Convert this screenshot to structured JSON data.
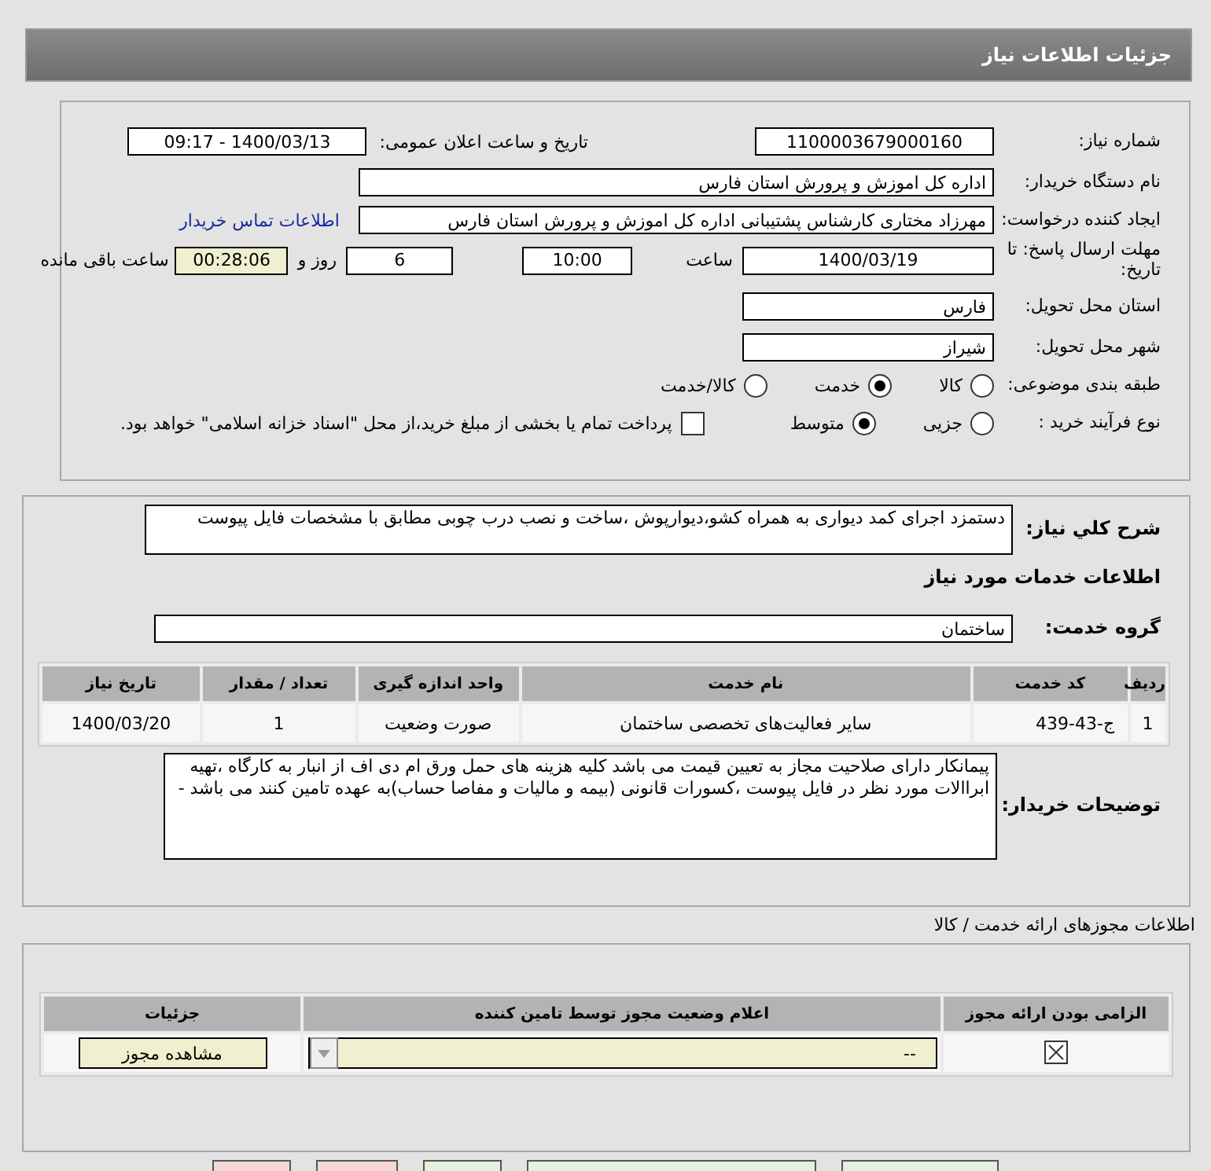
{
  "header": {
    "title": "جزئیات اطلاعات نیاز"
  },
  "need_number": {
    "label": "شماره نیاز:",
    "value": "1100003679000160"
  },
  "announce": {
    "label": "تاریخ و ساعت اعلان عمومی:",
    "value": "1400/03/13 - 09:17"
  },
  "buyer_org": {
    "label": "نام دستگاه خریدار:",
    "value": "اداره کل اموزش و پرورش استان فارس"
  },
  "requester": {
    "label": "ایجاد کننده درخواست:",
    "value": "مهرزاد  مختاری  کارشناس پشتیبانی اداره کل اموزش و پرورش استان فارس",
    "link": "اطلاعات تماس خریدار"
  },
  "deadline": {
    "label": "مهلت ارسال پاسخ: تا تاریخ:",
    "date": "1400/03/19",
    "time_label": "ساعت",
    "time": "10:00",
    "days": "6",
    "days_label": "روز و",
    "remaining": "00:28:06",
    "remaining_label": "ساعت باقی مانده"
  },
  "province": {
    "label": "استان محل تحویل:",
    "value": "فارس"
  },
  "city": {
    "label": "شهر محل تحویل:",
    "value": "شیراز"
  },
  "category": {
    "label": "طبقه بندی موضوعی:",
    "options": [
      {
        "label": "کالا",
        "selected": false
      },
      {
        "label": "خدمت",
        "selected": true
      },
      {
        "label": "کالا/خدمت",
        "selected": false
      }
    ]
  },
  "process": {
    "label": "نوع فرآیند خرید :",
    "options": [
      {
        "label": "جزیی",
        "selected": false
      },
      {
        "label": "متوسط",
        "selected": true
      }
    ],
    "payment": {
      "checked": false,
      "label": "پرداخت تمام یا بخشی از مبلغ خرید،از محل \"اسناد خزانه اسلامی\" خواهد بود."
    }
  },
  "description": {
    "label": "شرح کلي نياز:",
    "value": "دستمزد اجرای کمد دیواری به همراه کشو،دیوارپوش ،ساخت و نصب درب چوبی مطابق با مشخصات فایل پیوست"
  },
  "services_heading": "اطلاعات خدمات مورد نیاز",
  "service_group": {
    "label": "گروه خدمت:",
    "value": "ساختمان"
  },
  "services_table": {
    "columns": [
      "ردیف",
      "کد خدمت",
      "نام خدمت",
      "واحد اندازه گیری",
      "تعداد / مقدار",
      "تاریخ نیاز"
    ],
    "rows": [
      [
        "1",
        "ج-43-439",
        "سایر فعالیت‌های تخصصی ساختمان",
        "صورت وضعیت",
        "1",
        "1400/03/20"
      ]
    ]
  },
  "buyer_notes": {
    "label": "توضیحات خریدار:",
    "value": "پیمانکار دارای صلاحیت مجاز به تعیین قیمت می باشد کلیه هزینه های حمل ورق ام دی اف از انبار به کارگاه ،تهیه ابراالات مورد نظر در فایل پیوست ،کسورات قانونی (بیمه و مالیات و مفاصا حساب)به عهده تامین کنند می باشد -"
  },
  "permits": {
    "title": "اطلاعات مجوزهای ارائه خدمت / کالا",
    "columns": [
      "الزامی بودن ارائه مجوز",
      "اعلام وضعیت مجوز توسط تامین کننده",
      "جزئیات"
    ],
    "rows": [
      {
        "required": true,
        "status": "--",
        "details_button": "مشاهده مجوز"
      }
    ]
  },
  "bottom_buttons": [
    {
      "kind": "danger"
    },
    {
      "kind": "danger"
    },
    {
      "kind": "ok"
    },
    {
      "kind": "ok"
    },
    {
      "kind": "ok"
    }
  ]
}
